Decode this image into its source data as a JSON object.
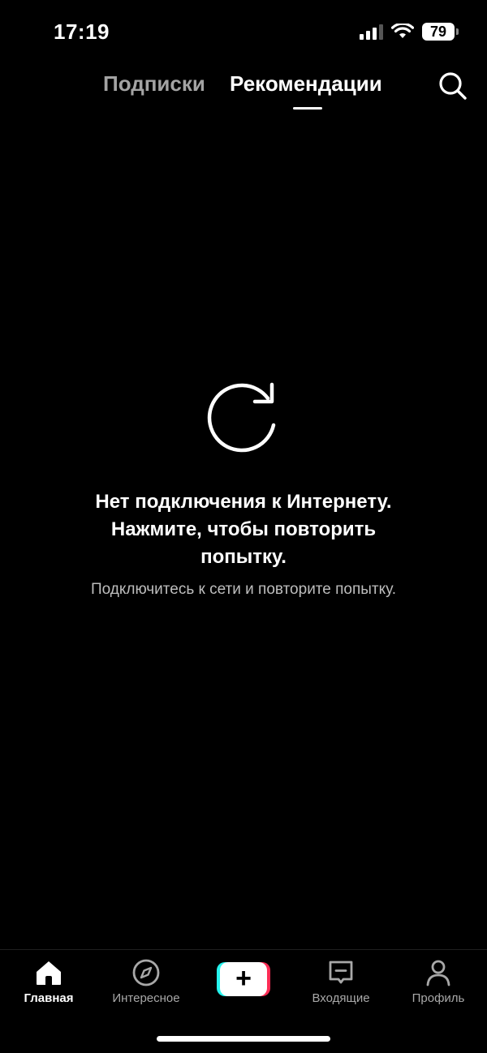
{
  "status_bar": {
    "time": "17:19",
    "battery_level": "79",
    "signal_icon": "cellular-signal-icon",
    "wifi_icon": "wifi-icon",
    "battery_icon": "battery-icon"
  },
  "header": {
    "tabs": [
      {
        "label": "Подписки",
        "active": false
      },
      {
        "label": "Рекомендации",
        "active": true
      }
    ],
    "search_icon": "search-icon"
  },
  "error": {
    "icon": "refresh-icon",
    "title": "Нет подключения к Интернету. Нажмите, чтобы повторить попытку.",
    "subtitle": "Подключитесь к сети и повторите попытку."
  },
  "bottom_nav": {
    "items": [
      {
        "label": "Главная",
        "icon": "home-icon",
        "active": true
      },
      {
        "label": "Интересное",
        "icon": "compass-icon",
        "active": false
      },
      {
        "label": "",
        "icon": "plus-icon",
        "active": false
      },
      {
        "label": "Входящие",
        "icon": "inbox-icon",
        "active": false
      },
      {
        "label": "Профиль",
        "icon": "profile-icon",
        "active": false
      }
    ]
  },
  "colors": {
    "background": "#000000",
    "accent_cyan": "#25f4ee",
    "accent_pink": "#fe2c55",
    "inactive_tab": "#a3a3a3"
  }
}
